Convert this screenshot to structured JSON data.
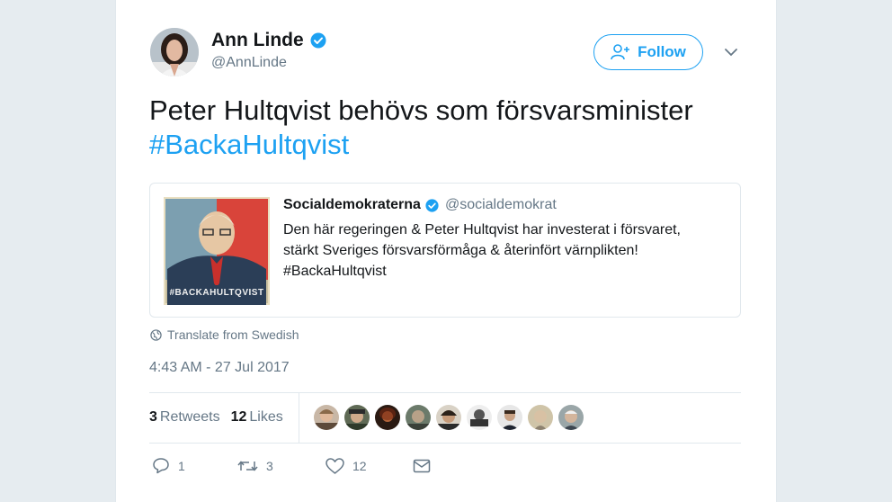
{
  "author": {
    "name": "Ann Linde",
    "handle": "@AnnLinde"
  },
  "follow_label": "Follow",
  "tweet": {
    "text": "Peter Hultqvist behövs som försvarsminister",
    "hashtag": "#BackaHultqvist"
  },
  "quote": {
    "name": "Socialdemokraterna",
    "handle": "@socialdemokrat",
    "line1": "Den här regeringen & Peter Hultqvist har investerat i försvaret,",
    "line2": "stärkt Sveriges försvarsförmåga & återinfört värnplikten!",
    "line3": "#BackaHultqvist",
    "image_caption": "#BACKAHULTQVIST"
  },
  "translate_label": "Translate from Swedish",
  "timestamp": "4:43 AM - 27 Jul 2017",
  "stats": {
    "retweets_count": "3",
    "retweets_label": "Retweets",
    "likes_count": "12",
    "likes_label": "Likes"
  },
  "actions": {
    "replies": "1",
    "retweets": "3",
    "likes": "12"
  },
  "colors": {
    "accent": "#1da1f2",
    "muted": "#657786",
    "text": "#14171a",
    "border": "#e1e8ed"
  }
}
